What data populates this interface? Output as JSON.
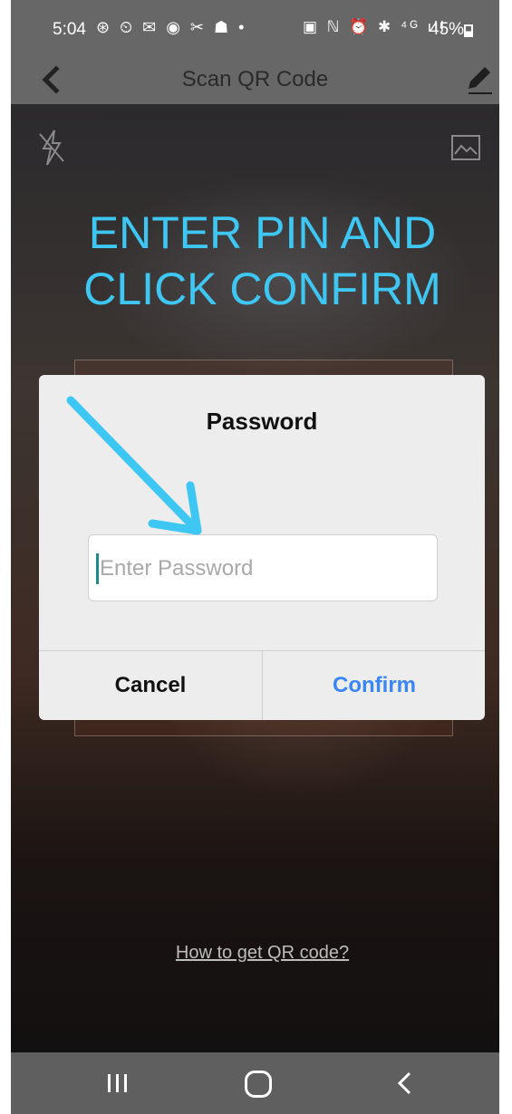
{
  "status_bar": {
    "time": "5:04",
    "left_icons": "⊛ ⏲ ✉ ◉ ✂ ☗ •",
    "right_icons": "▣ ℕ ⏰ ✱ ⁴ᴳ ıll",
    "battery": "45%"
  },
  "app_bar": {
    "title": "Scan QR Code"
  },
  "instruction": {
    "line1": "ENTER PIN AND",
    "line2": "CLICK CONFIRM",
    "color": "#3ec7f2"
  },
  "dialog": {
    "title": "Password",
    "input_placeholder": "Enter Password",
    "input_value": "",
    "cancel_label": "Cancel",
    "confirm_label": "Confirm",
    "confirm_color": "#3a86f4"
  },
  "help_link": "How to get QR code?"
}
